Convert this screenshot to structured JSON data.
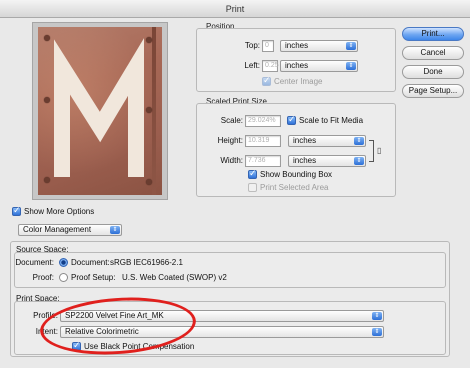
{
  "window": {
    "title": "Print"
  },
  "preview": {
    "letter": "M"
  },
  "position": {
    "group_label": "Position",
    "top_label": "Top:",
    "top_value": "0",
    "top_unit": "inches",
    "left_label": "Left:",
    "left_value": "0.25",
    "left_unit": "inches",
    "center_image_label": "Center Image",
    "center_image_checked": true
  },
  "scaled": {
    "group_label": "Scaled Print Size",
    "scale_label": "Scale:",
    "scale_value": "29.024%",
    "scale_to_fit_label": "Scale to Fit Media",
    "height_label": "Height:",
    "height_value": "10.319",
    "height_unit": "inches",
    "width_label": "Width:",
    "width_value": "7.736",
    "width_unit": "inches",
    "show_bounding_box_label": "Show Bounding Box",
    "print_selected_area_label": "Print Selected Area"
  },
  "buttons": {
    "print": "Print...",
    "cancel": "Cancel",
    "done": "Done",
    "page_setup": "Page Setup..."
  },
  "more_options": {
    "label": "Show More Options",
    "dropdown": "Color Management"
  },
  "source_space": {
    "group_label": "Source Space:",
    "document_label": "Document:",
    "document_option": "Document:",
    "document_value": "sRGB IEC61966-2.1",
    "proof_label": "Proof:",
    "proof_option": "Proof Setup:",
    "proof_value": "U.S. Web Coated (SWOP) v2"
  },
  "print_space": {
    "group_label": "Print Space:",
    "profile_label": "Profile:",
    "profile_value": "SP2200 Velvet Fine Art_MK",
    "intent_label": "Intent:",
    "intent_value": "Relative Colorimetric",
    "bpc_label": "Use Black Point Compensation"
  },
  "colors": {
    "annotation": "#e0201d",
    "accent": "#3e86ea"
  }
}
